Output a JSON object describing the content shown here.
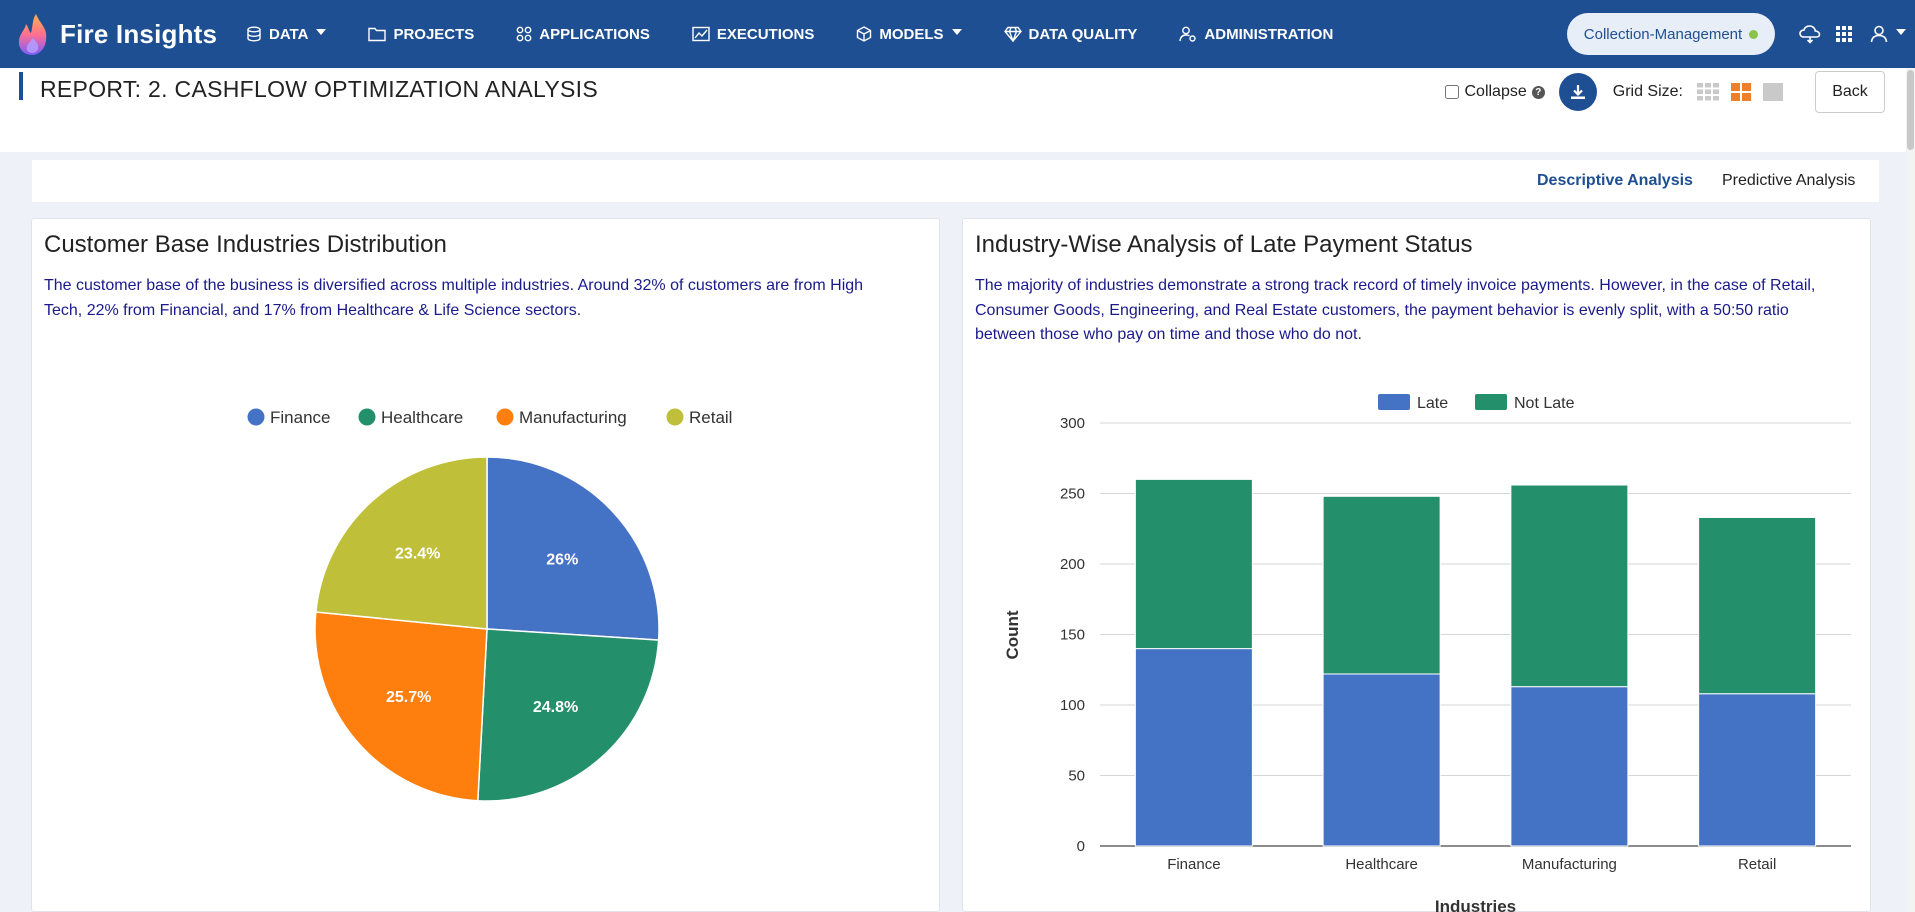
{
  "brand": {
    "name": "Fire Insights"
  },
  "nav": {
    "items": [
      {
        "label": "DATA",
        "icon": "database-icon",
        "dropdown": true
      },
      {
        "label": "PROJECTS",
        "icon": "folder-icon",
        "dropdown": false
      },
      {
        "label": "APPLICATIONS",
        "icon": "apps-grid-icon",
        "dropdown": false
      },
      {
        "label": "EXECUTIONS",
        "icon": "chart-line-icon",
        "dropdown": false
      },
      {
        "label": "MODELS",
        "icon": "cube-icon",
        "dropdown": true
      },
      {
        "label": "DATA QUALITY",
        "icon": "diamond-icon",
        "dropdown": false
      },
      {
        "label": "ADMINISTRATION",
        "icon": "user-admin-icon",
        "dropdown": false
      }
    ],
    "project": "Collection-Management",
    "status_color": "#8bc34a"
  },
  "report": {
    "title": "REPORT: 2. CASHFLOW OPTIMIZATION ANALYSIS",
    "collapse_label": "Collapse",
    "help": "?",
    "grid_label": "Grid Size:",
    "back_label": "Back"
  },
  "tabs": [
    {
      "label": "Descriptive Analysis",
      "active": true
    },
    {
      "label": "Predictive Analysis",
      "active": false
    }
  ],
  "cards": {
    "left": {
      "title": "Customer Base Industries Distribution",
      "description": "The customer base of the business is diversified across multiple industries. Around 32% of customers are from High Tech, 22% from Financial, and 17% from Healthcare & Life Science sectors."
    },
    "right": {
      "title": "Industry-Wise Analysis of Late Payment Status",
      "description": "The majority of industries demonstrate a strong track record of timely invoice payments. However, in the case of Retail, Consumer Goods, Engineering, and Real Estate customers, the payment behavior is evenly split, with a 50:50 ratio between those who pay on time and those who do not."
    }
  },
  "colors": {
    "navbar": "#1f4f93",
    "finance": "#4472c4",
    "healthcare": "#248f6b",
    "manufacturing": "#ff7f0e",
    "retail": "#bfbf3a"
  },
  "chart_data": [
    {
      "type": "pie",
      "title": "",
      "categories": [
        "Finance",
        "Healthcare",
        "Manufacturing",
        "Retail"
      ],
      "values": [
        26,
        24.8,
        25.7,
        23.4
      ],
      "labels": [
        "26%",
        "24.8%",
        "25.7%",
        "23.4%"
      ],
      "colors": [
        "#4472c4",
        "#248f6b",
        "#ff7f0e",
        "#bfbf3a"
      ],
      "legend": "top"
    },
    {
      "type": "bar",
      "stacked": true,
      "title": "",
      "categories": [
        "Finance",
        "Healthcare",
        "Manufacturing",
        "Retail"
      ],
      "series": [
        {
          "name": "Late",
          "values": [
            140,
            122,
            113,
            108
          ],
          "color": "#4472c4"
        },
        {
          "name": "Not Late",
          "values": [
            120,
            126,
            143,
            125
          ],
          "color": "#248f6b"
        }
      ],
      "xlabel": "Industries",
      "ylabel": "Count",
      "ylim": [
        0,
        300
      ],
      "yticks": [
        0,
        50,
        100,
        150,
        200,
        250,
        300
      ],
      "grid": true,
      "legend": "top"
    }
  ]
}
